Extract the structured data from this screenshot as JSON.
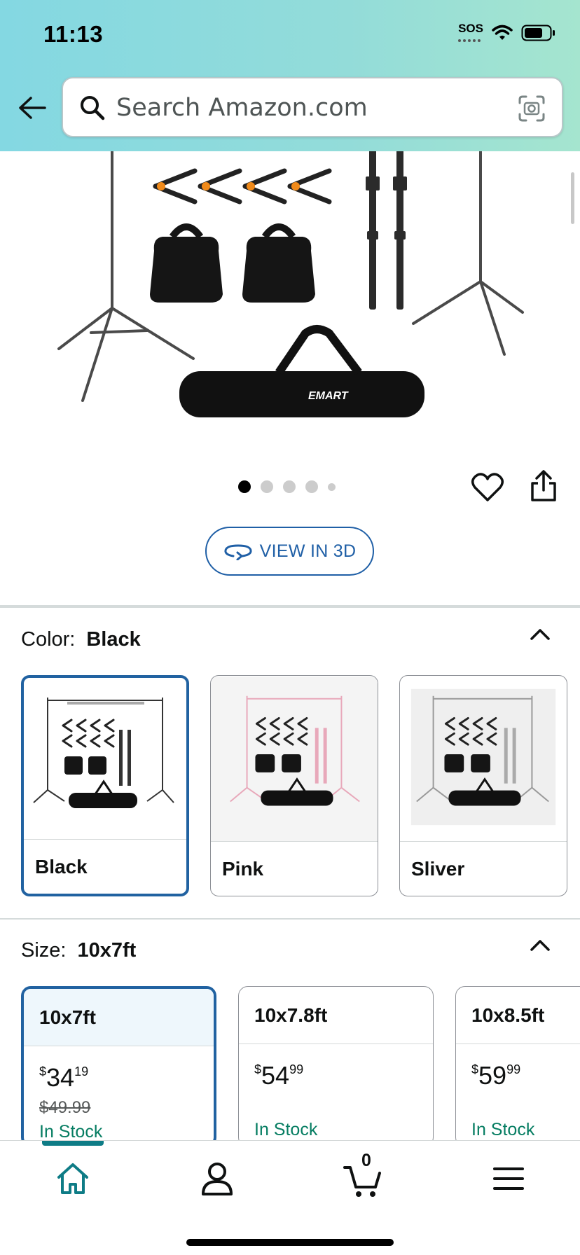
{
  "status_bar": {
    "time": "11:13",
    "sos": "SOS"
  },
  "search": {
    "placeholder": "Search Amazon.com"
  },
  "product": {
    "brand_on_bag": "EMART",
    "view_3d_label": "VIEW IN 3D"
  },
  "colors": {
    "accent": "#2162a1",
    "in_stock": "#067d62",
    "teal": "#0e7c86"
  },
  "color_selector": {
    "label": "Color:",
    "selected": "Black",
    "options": [
      {
        "name": "Black"
      },
      {
        "name": "Pink"
      },
      {
        "name": "Sliver"
      }
    ]
  },
  "size_selector": {
    "label": "Size:",
    "selected": "10x7ft",
    "options": [
      {
        "name": "10x7ft",
        "price_whole": "34",
        "price_fraction": "19",
        "currency": "$",
        "original_price": "$49.99",
        "stock": "In Stock"
      },
      {
        "name": "10x7.8ft",
        "price_whole": "54",
        "price_fraction": "99",
        "currency": "$",
        "original_price": "",
        "stock": "In Stock"
      },
      {
        "name": "10x8.5ft",
        "price_whole": "59",
        "price_fraction": "99",
        "currency": "$",
        "original_price": "",
        "stock": "In Stock"
      }
    ]
  },
  "bottom_nav": {
    "cart_count": "0"
  }
}
